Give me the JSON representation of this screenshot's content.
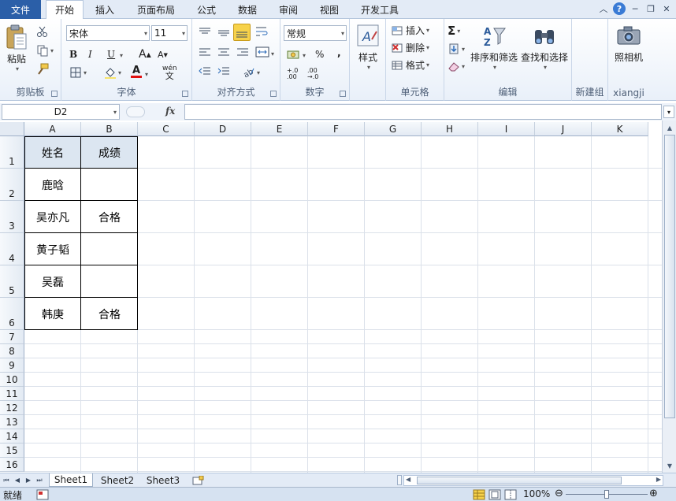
{
  "tabs": {
    "file": "文件",
    "items": [
      "开始",
      "插入",
      "页面布局",
      "公式",
      "数据",
      "审阅",
      "视图",
      "开发工具"
    ],
    "active": "开始"
  },
  "ribbon": {
    "clipboard": {
      "label": "剪贴板",
      "paste": "粘贴"
    },
    "font": {
      "label": "字体",
      "name": "宋体",
      "size": "11",
      "bold": "B",
      "italic": "I",
      "underline": "U",
      "grow": "A",
      "shrink": "A",
      "font_color_letter": "A",
      "phonetic": "wén"
    },
    "alignment": {
      "label": "对齐方式"
    },
    "number": {
      "label": "数字",
      "format": "常规",
      "percent": "%",
      "comma": ",",
      "inc": "+.0 .00",
      "dec": ".00 →.0"
    },
    "styles": {
      "label": "样式"
    },
    "cells": {
      "label": "单元格",
      "insert": "插入",
      "delete": "删除",
      "format": "格式"
    },
    "editing": {
      "label": "编辑",
      "sort": "排序和筛选",
      "find": "查找和选择"
    },
    "newgroup": {
      "label": "新建组"
    },
    "xiangji": {
      "label": "xiangji",
      "camera": "照相机"
    }
  },
  "formula_bar": {
    "name_box": "D2",
    "fx": "fx",
    "value": ""
  },
  "grid": {
    "columns": [
      "A",
      "B",
      "C",
      "D",
      "E",
      "F",
      "G",
      "H",
      "I",
      "J",
      "K"
    ],
    "rows": [
      "1",
      "2",
      "3",
      "4",
      "5",
      "6",
      "7",
      "8",
      "9",
      "10",
      "11",
      "12",
      "13",
      "14",
      "15",
      "16"
    ],
    "cells": {
      "A1": "姓名",
      "B1": "成绩",
      "A2": "鹿晗",
      "B2": "",
      "A3": "吴亦凡",
      "B3": "合格",
      "A4": "黄子韬",
      "B4": "",
      "A5": "吴磊",
      "B5": "",
      "A6": "韩庚",
      "B6": "合格"
    },
    "header_fill": "#dce6f1"
  },
  "sheets": {
    "items": [
      "Sheet1",
      "Sheet2",
      "Sheet3"
    ],
    "active": "Sheet1"
  },
  "status": {
    "ready": "就绪",
    "zoom": "100%"
  },
  "colors": {
    "file_tab": "#2b5fa8",
    "ribbon_bg": "#e9f0f9",
    "accent_highlight": "#f7d24a"
  }
}
